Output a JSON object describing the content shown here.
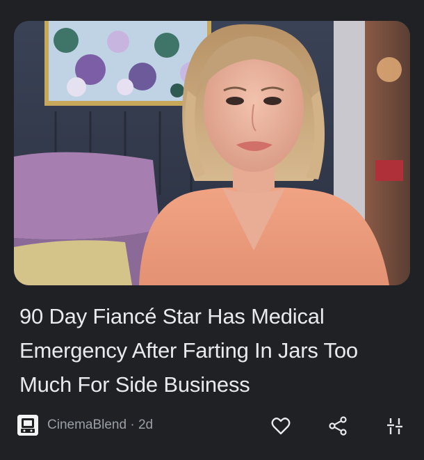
{
  "article": {
    "headline": "90 Day Fiancé Star Has Medical Emergency After Farting In Jars Too Much For Side Business",
    "source": "CinemaBlend",
    "separator": "·",
    "age": "2d"
  },
  "actions": {
    "like_icon": "heart-icon",
    "share_icon": "share-icon",
    "more_icon": "adjust-icon"
  },
  "colors": {
    "background": "#202124",
    "headline_text": "#e8eaed",
    "meta_text": "#9aa0a6",
    "icon": "#e8eaed"
  }
}
